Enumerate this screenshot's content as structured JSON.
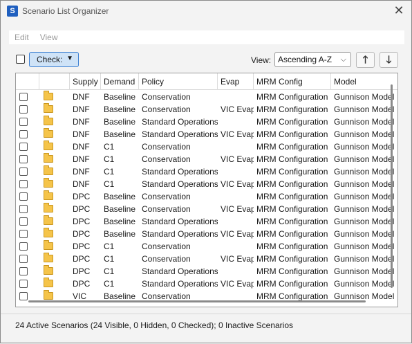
{
  "window": {
    "title": "Scenario List Organizer",
    "icon_letter": "S",
    "close_glyph": "✕"
  },
  "menu": [
    "Edit",
    "View"
  ],
  "toolbar": {
    "check_label": "Check:",
    "view_label": "View:",
    "view_value": "Ascending A-Z",
    "up_glyph": "🡑",
    "down_glyph": "🡓"
  },
  "table": {
    "columns": [
      "",
      "",
      "Supply",
      "Demand",
      "Policy",
      "Evap",
      "MRM Config",
      "Model"
    ],
    "rows": [
      [
        "DNF",
        "Baseline",
        "Conservation",
        "",
        "MRM Configuration",
        "Gunnison Model"
      ],
      [
        "DNF",
        "Baseline",
        "Conservation",
        "VIC Evap",
        "MRM Configuration",
        "Gunnison Model"
      ],
      [
        "DNF",
        "Baseline",
        "Standard Operations",
        "",
        "MRM Configuration",
        "Gunnison Model"
      ],
      [
        "DNF",
        "Baseline",
        "Standard Operations",
        "VIC Evap",
        "MRM Configuration",
        "Gunnison Model"
      ],
      [
        "DNF",
        "C1",
        "Conservation",
        "",
        "MRM Configuration",
        "Gunnison Model"
      ],
      [
        "DNF",
        "C1",
        "Conservation",
        "VIC Evap",
        "MRM Configuration",
        "Gunnison Model"
      ],
      [
        "DNF",
        "C1",
        "Standard Operations",
        "",
        "MRM Configuration",
        "Gunnison Model"
      ],
      [
        "DNF",
        "C1",
        "Standard Operations",
        "VIC Evap",
        "MRM Configuration",
        "Gunnison Model"
      ],
      [
        "DPC",
        "Baseline",
        "Conservation",
        "",
        "MRM Configuration",
        "Gunnison Model"
      ],
      [
        "DPC",
        "Baseline",
        "Conservation",
        "VIC Evap",
        "MRM Configuration",
        "Gunnison Model"
      ],
      [
        "DPC",
        "Baseline",
        "Standard Operations",
        "",
        "MRM Configuration",
        "Gunnison Model"
      ],
      [
        "DPC",
        "Baseline",
        "Standard Operations",
        "VIC Evap",
        "MRM Configuration",
        "Gunnison Model"
      ],
      [
        "DPC",
        "C1",
        "Conservation",
        "",
        "MRM Configuration",
        "Gunnison Model"
      ],
      [
        "DPC",
        "C1",
        "Conservation",
        "VIC Evap",
        "MRM Configuration",
        "Gunnison Model"
      ],
      [
        "DPC",
        "C1",
        "Standard Operations",
        "",
        "MRM Configuration",
        "Gunnison Model"
      ],
      [
        "DPC",
        "C1",
        "Standard Operations",
        "VIC Evap",
        "MRM Configuration",
        "Gunnison Model"
      ],
      [
        "VIC",
        "Baseline",
        "Conservation",
        "",
        "MRM Configuration",
        "Gunnison Model"
      ]
    ]
  },
  "status": "24 Active Scenarios (24 Visible, 0 Hidden, 0 Checked); 0 Inactive Scenarios"
}
